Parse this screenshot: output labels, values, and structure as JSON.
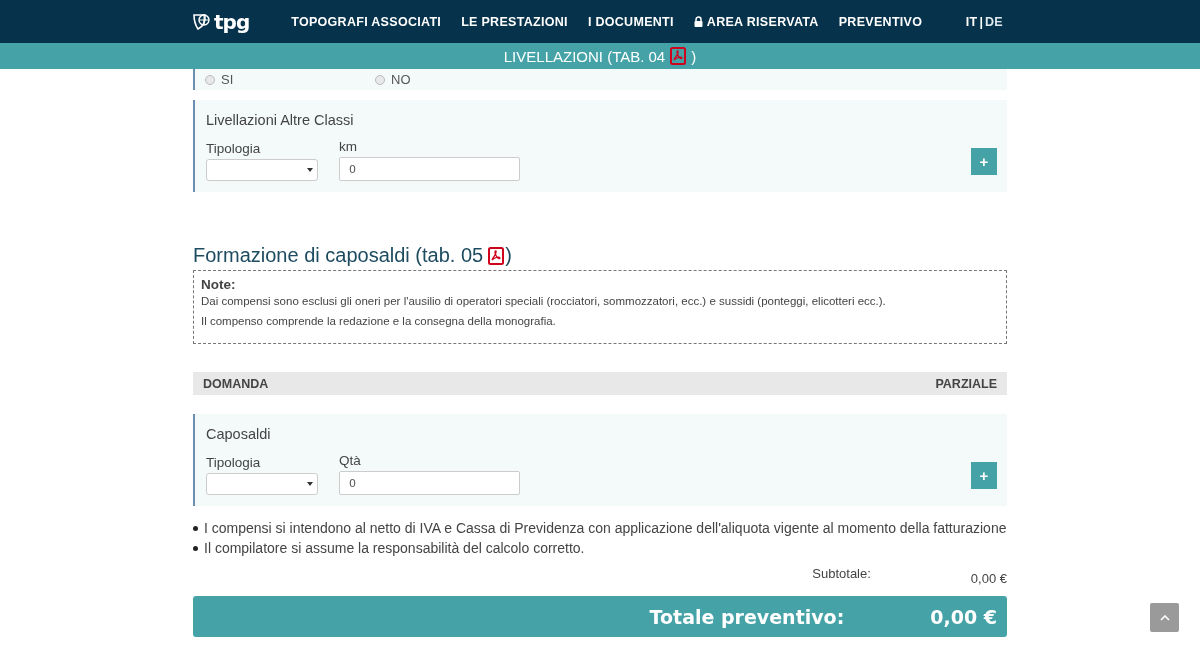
{
  "header": {
    "logo": "tpg",
    "nav": [
      {
        "label": "TOPOGRAFI ASSOCIATI",
        "kind": "plain"
      },
      {
        "label": "LE PRESTAZIONI",
        "kind": "plain"
      },
      {
        "label": "I DOCUMENTI",
        "kind": "plain"
      },
      {
        "label": "AREA RISERVATA",
        "kind": "locked"
      },
      {
        "label": "PREVENTIVO",
        "kind": "plain"
      }
    ],
    "languages": [
      {
        "label": "IT",
        "selected": true
      },
      {
        "label": "DE",
        "selected": false
      }
    ],
    "language_separator": "|"
  },
  "sticky_bar": {
    "title": "LIVELLAZIONI (TAB. 04",
    "title_end": ")"
  },
  "partial_options": [
    {
      "label": "SI",
      "selected": false
    },
    {
      "label": "NO",
      "selected": false
    }
  ],
  "card_1": {
    "title": "Livellazioni Altre Classi",
    "fields": [
      {
        "kind": "select",
        "label": "Tipologia"
      },
      {
        "kind": "input",
        "label": "km",
        "value": "0"
      }
    ],
    "add_button": "+"
  },
  "section": {
    "title": "Formazione di caposaldi (tab. 05",
    "title_end": ")"
  },
  "note": {
    "heading": "Note:",
    "lines": [
      "Dai compensi sono esclusi gli oneri per l'ausilio di operatori speciali (rocciatori, sommozzatori, ecc.) e sussidi (ponteggi, elicotteri ecc.).",
      "Il compenso comprende la redazione e la consegna della monografia."
    ]
  },
  "table_header": {
    "columns": [
      "DOMANDA",
      "PARZIALE"
    ]
  },
  "card_2": {
    "title": "Caposaldi",
    "fields": [
      {
        "kind": "select",
        "label": "Tipologia"
      },
      {
        "kind": "input",
        "label": "Qtà",
        "value": "0"
      }
    ],
    "add_button": "+"
  },
  "bullets": [
    "I compensi si intendono al netto di IVA e Cassa di Previdenza con applicazione dell'aliquota vigente al momento della fatturazione",
    "Il compilatore si assume la responsabilità del calcolo corretto."
  ],
  "subtotal": {
    "label": "Subtotale:",
    "value": "0,00 €"
  },
  "total": {
    "label": "Totale preventivo:",
    "value": "0,00 €"
  }
}
